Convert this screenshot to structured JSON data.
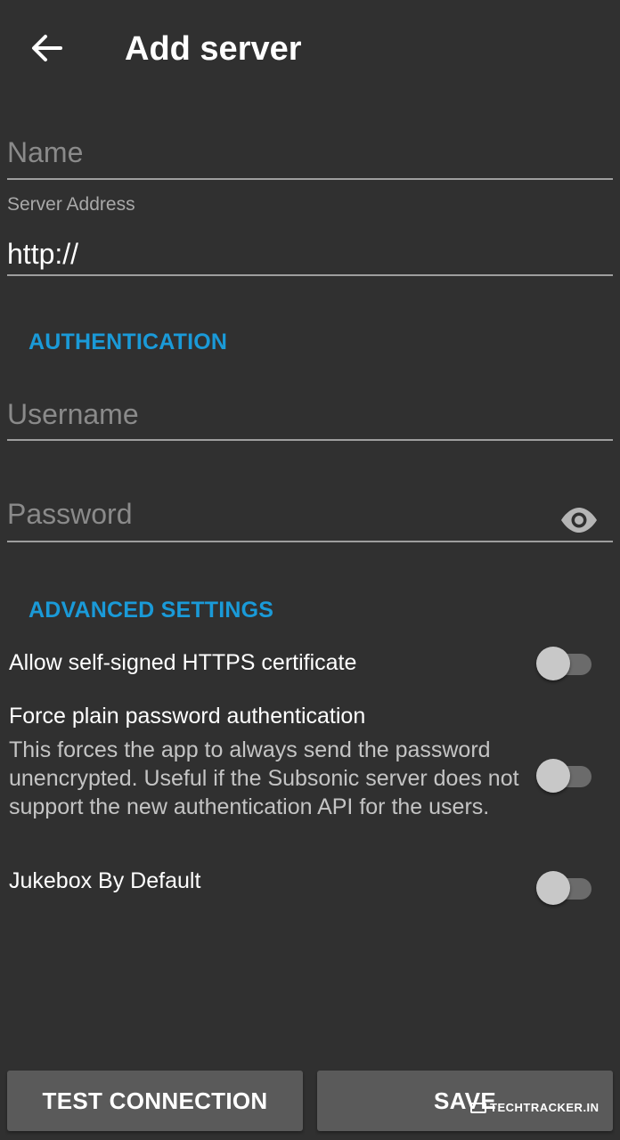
{
  "header": {
    "back_icon": "arrow-left-icon",
    "title": "Add server"
  },
  "form": {
    "name": {
      "placeholder": "Name",
      "value": ""
    },
    "server_address": {
      "label": "Server Address",
      "value": "http://"
    }
  },
  "authentication": {
    "section_title": "AUTHENTICATION",
    "username": {
      "placeholder": "Username",
      "value": ""
    },
    "password": {
      "placeholder": "Password",
      "value": "",
      "toggle_icon": "eye-icon"
    }
  },
  "advanced": {
    "section_title": "ADVANCED SETTINGS",
    "settings": [
      {
        "title": "Allow self-signed HTTPS certificate",
        "enabled": false
      },
      {
        "title": "Force plain password authentication",
        "summary": "This forces the app to always send the password unencrypted. Useful if the Subsonic server does not support the new authentication API for the users.",
        "enabled": false
      },
      {
        "title": "Jukebox By Default",
        "enabled": false
      }
    ]
  },
  "actions": {
    "test_connection": "TEST CONNECTION",
    "save": "SAVE"
  },
  "watermark": "TECHTRACKER.IN",
  "colors": {
    "background": "#303030",
    "accent": "#1a9ad8",
    "button": "#5a5a5a",
    "divider": "#9e9e9e"
  }
}
